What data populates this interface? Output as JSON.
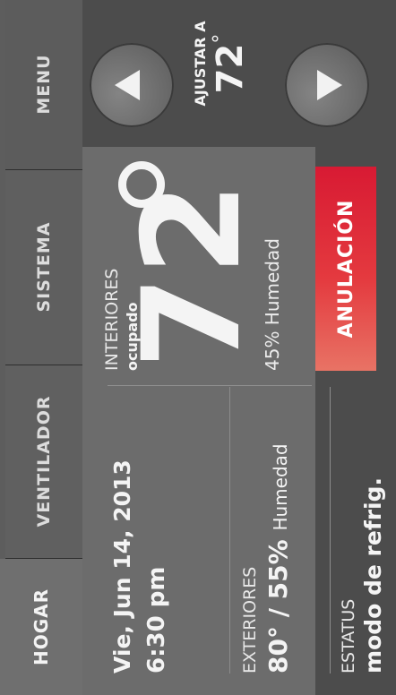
{
  "tabs": {
    "home": "HOGAR",
    "fan": "VENTILADOR",
    "system": "SISTEMA",
    "menu": "MENU"
  },
  "datetime": {
    "date": "Vie, Jun 14, 2013",
    "time": "6:30 pm"
  },
  "outdoor": {
    "label": "EXTERIORES",
    "temp_humidity": "80° / 55%",
    "humidity_word": "Humedad"
  },
  "status": {
    "label": "ESTATUS",
    "value": "modo de refrig."
  },
  "indoor": {
    "label": "INTERIORES",
    "occupancy": "ocupado",
    "temperature": "72",
    "humidity": "45% Humedad"
  },
  "override_button": "ANULACIÓN",
  "setpoint": {
    "label": "AJUSTAR A",
    "value": "72",
    "degree": "°"
  },
  "icons": [
    "arrow-up-icon",
    "arrow-down-icon"
  ],
  "colors": {
    "override_red": "#e43a3f",
    "panel_bg": "#6c6c6c",
    "background": "#4a4a4a"
  }
}
